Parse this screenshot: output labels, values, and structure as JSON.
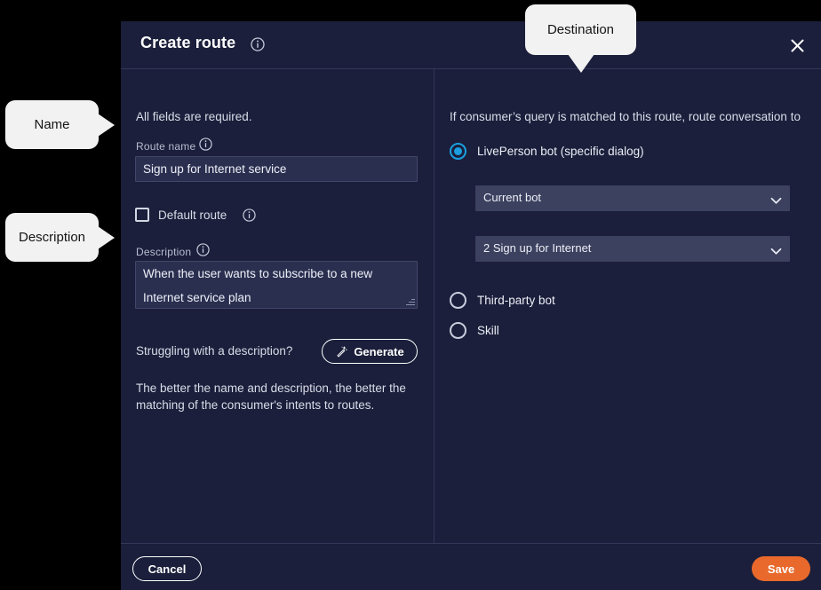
{
  "modal": {
    "title": "Create route",
    "title_info_icon": "info-circle-icon",
    "close_icon": "close-icon",
    "left": {
      "all_fields_note": "All fields are required.",
      "route_name_label": "Route name",
      "route_name_info_icon": "info-circle-icon",
      "route_name_value": "Sign up for Internet service",
      "route_name_placeholder": "",
      "default_route_label": "Default route",
      "default_route_checked": false,
      "default_route_info_icon": "info-circle-icon",
      "description_label": "Description",
      "description_info_icon": "info-circle-icon",
      "description_value": "When the user wants to subscribe to a new Internet service plan",
      "description_placeholder": "",
      "struggling_text": "Struggling with a description?",
      "generate_label": "Generate",
      "generate_icon": "magic-wand-icon",
      "better_note": "The better the name and description, the better the matching of the consumer's intents to routes."
    },
    "right": {
      "question": "If consumer’s query is matched to this route, route conversation to",
      "options": [
        {
          "label": "LivePerson bot (specific dialog)",
          "selected": true
        },
        {
          "label": "Third-party bot",
          "selected": false
        },
        {
          "label": "Skill",
          "selected": false
        }
      ],
      "bot_select": {
        "value": "Current bot",
        "chevron_icon": "chevron-down-icon"
      },
      "dialog_select": {
        "value": "2 Sign up for Internet",
        "chevron_icon": "chevron-down-icon"
      }
    },
    "footer": {
      "cancel_label": "Cancel",
      "save_label": "Save"
    }
  },
  "callouts": {
    "name": "Name",
    "description": "Description",
    "destination": "Destination"
  },
  "colors": {
    "modal_background": "#1b1f3b",
    "page_background": "#000000",
    "input_background": "#2a2f50",
    "select_background": "#3c415f",
    "divider": "#33375a",
    "accent_radio": "#1b9fe0",
    "save_button": "#e8692b",
    "callout_background": "#f2f2f2",
    "text_primary": "#ffffff",
    "text_secondary": "#d9dce8",
    "label_muted": "#b9bdd0"
  }
}
